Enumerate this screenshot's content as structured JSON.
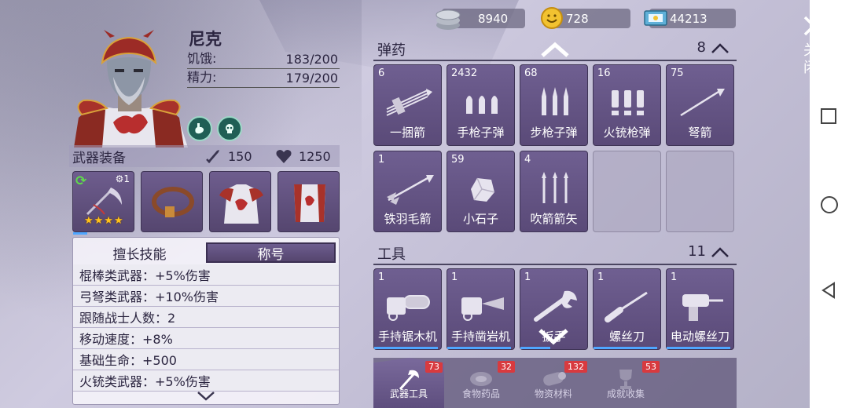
{
  "currency": [
    {
      "icon": "coin-stack-icon",
      "amount": "8940"
    },
    {
      "icon": "smiley-coin-icon",
      "amount": "728"
    },
    {
      "icon": "ticket-icon",
      "amount": "44213"
    }
  ],
  "character": {
    "name": "尼克",
    "hunger_label": "饥饿:",
    "hunger_value": "183/200",
    "energy_label": "精力:",
    "energy_value": "179/200"
  },
  "equipment": {
    "title": "武器装备",
    "attack": "150",
    "health": "1250",
    "weapon_level": "1",
    "weapon_stars": "★★★★"
  },
  "skills": {
    "tabs": [
      "擅长技能",
      "称号"
    ],
    "rows": [
      "棍棒类武器：+5%伤害",
      "弓弩类武器：+10%伤害",
      "跟随战士人数：2",
      "移动速度：+8%",
      "基础生命：+500",
      "火铳类武器：+5%伤害"
    ]
  },
  "ammo": {
    "title": "弹药",
    "count": "8",
    "items": [
      {
        "count": "6",
        "label": "一捆箭"
      },
      {
        "count": "2432",
        "label": "手枪子弹"
      },
      {
        "count": "68",
        "label": "步枪子弹"
      },
      {
        "count": "16",
        "label": "火铳枪弹"
      },
      {
        "count": "75",
        "label": "弩箭"
      },
      {
        "count": "1",
        "label": "铁羽毛箭"
      },
      {
        "count": "59",
        "label": "小石子"
      },
      {
        "count": "4",
        "label": "吹箭箭矢"
      }
    ]
  },
  "tools": {
    "title": "工具",
    "count": "11",
    "items": [
      {
        "count": "1",
        "label": "手持锯木机",
        "durability": 0.95
      },
      {
        "count": "1",
        "label": "手持凿岩机",
        "durability": 0.95
      },
      {
        "count": "1",
        "label": "扳手",
        "durability": 0.45
      },
      {
        "count": "1",
        "label": "螺丝刀",
        "durability": 0.95
      },
      {
        "count": "1",
        "label": "电动螺丝刀",
        "durability": 0.95
      }
    ]
  },
  "bottom_tabs": [
    {
      "label": "武器工具",
      "badge": "73",
      "icon": "axe-icon"
    },
    {
      "label": "食物药品",
      "badge": "32",
      "icon": "meat-icon"
    },
    {
      "label": "物资材料",
      "badge": "132",
      "icon": "log-icon"
    },
    {
      "label": "成就收集",
      "badge": "53",
      "icon": "trophy-icon"
    }
  ],
  "close_label": "关闭",
  "colors": {
    "accent": "#6f5f91",
    "badge": "#d83a3f",
    "star": "#ffc21a"
  }
}
